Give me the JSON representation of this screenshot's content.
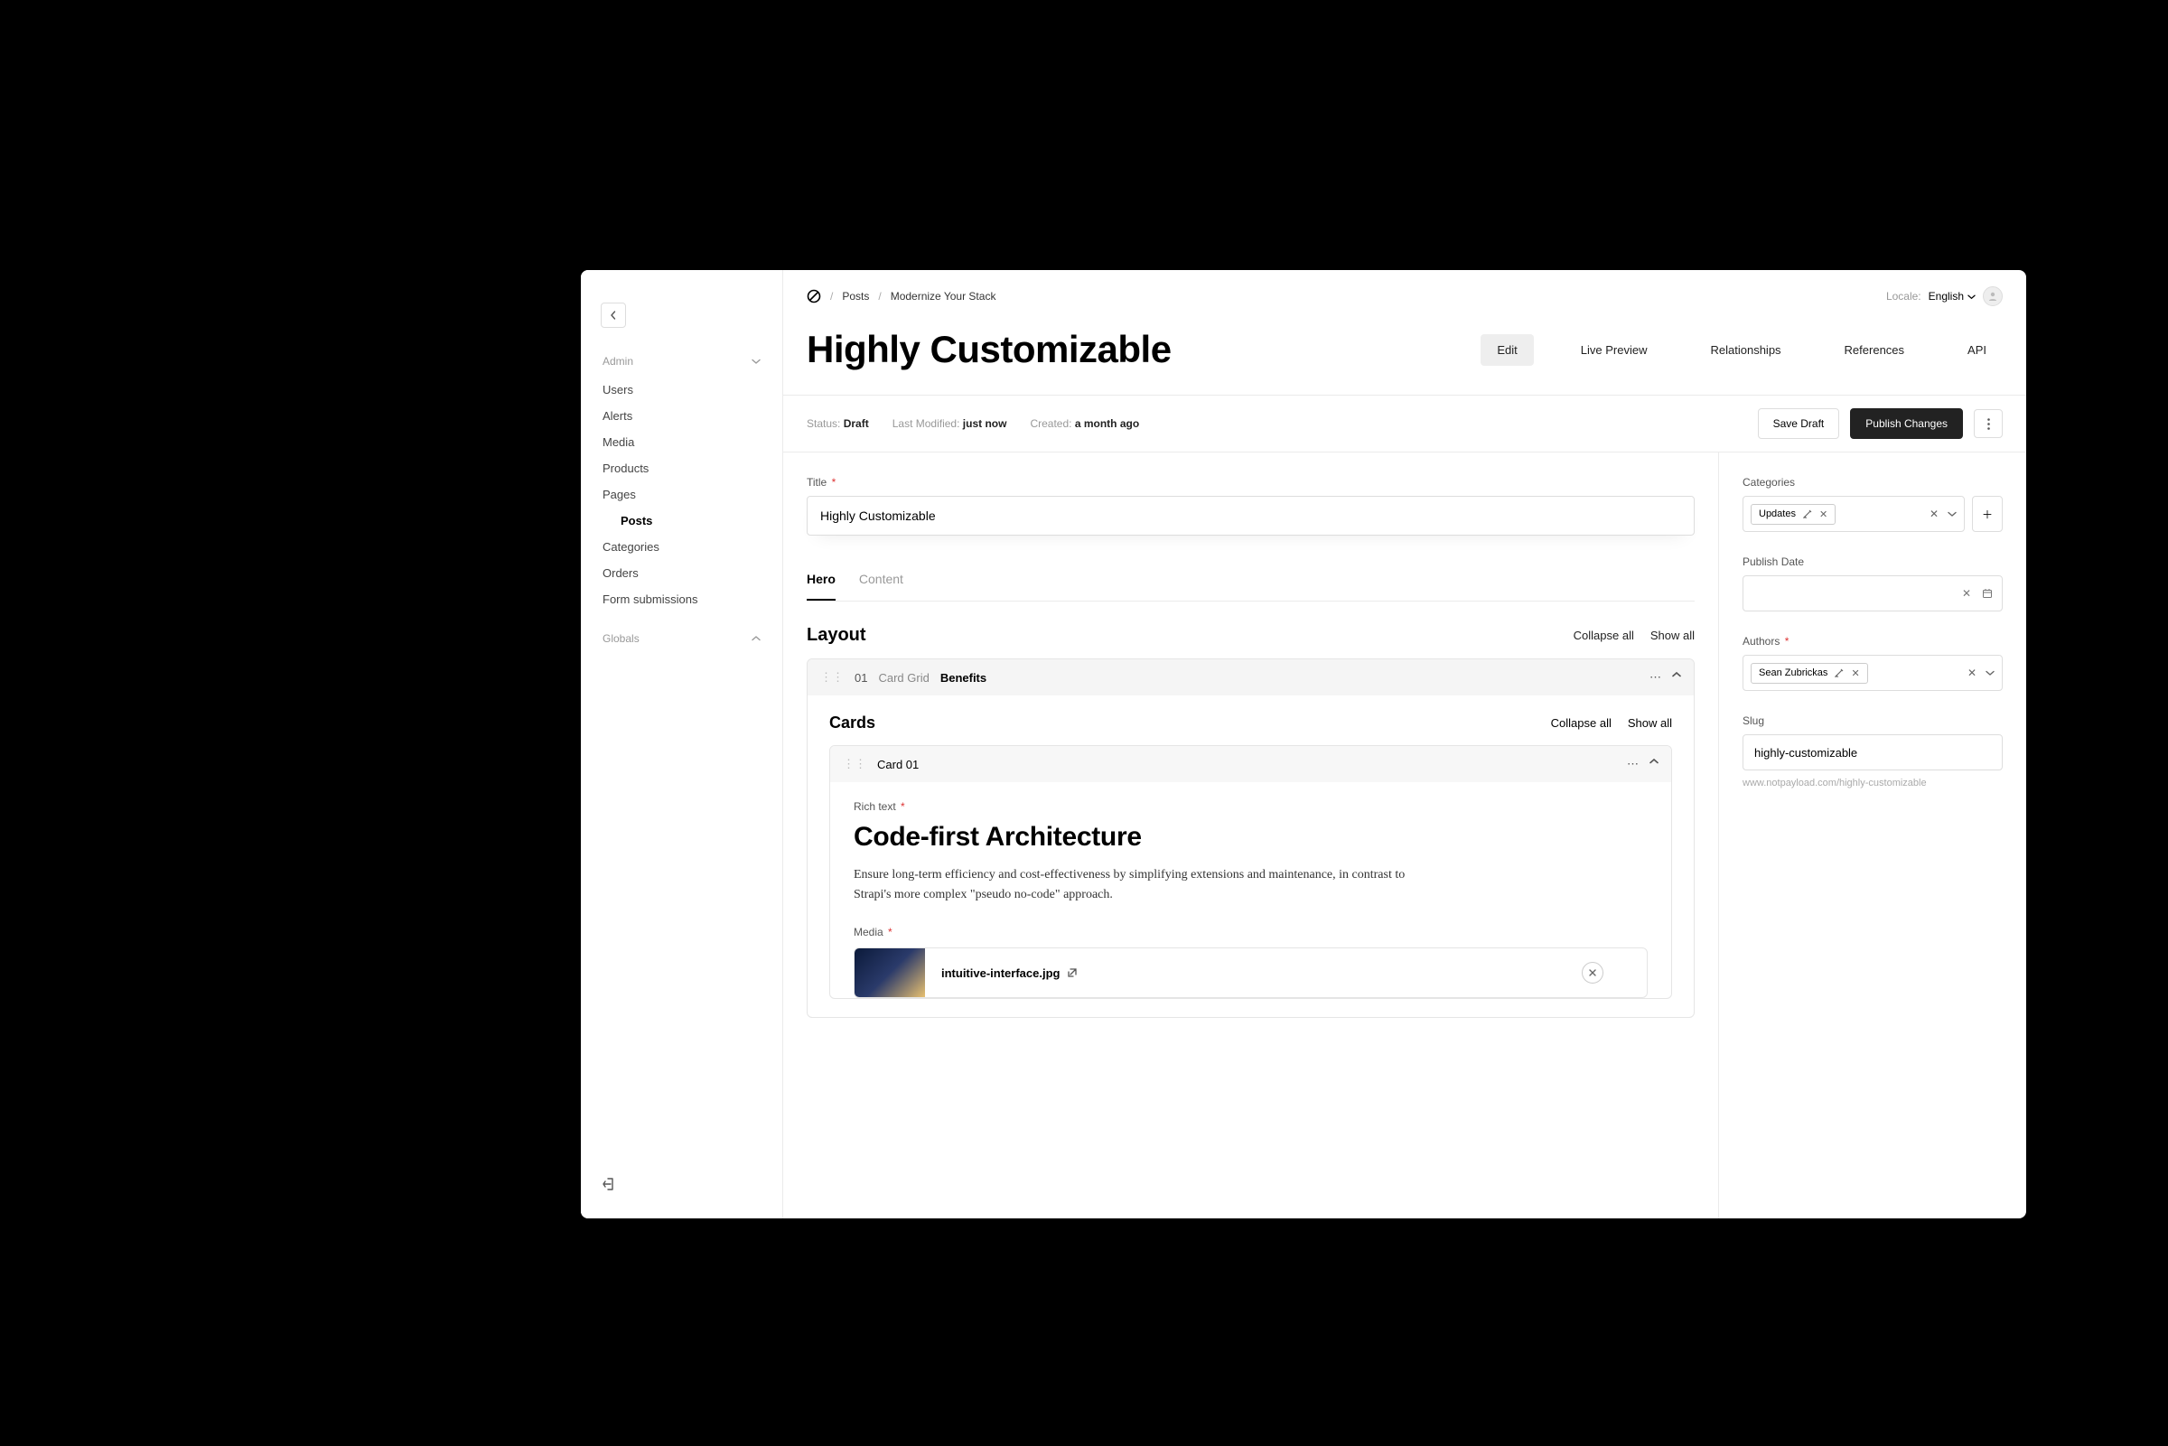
{
  "breadcrumbs": {
    "root": "Posts",
    "current": "Modernize Your Stack"
  },
  "locale": {
    "label": "Locale:",
    "value": "English"
  },
  "page_title": "Highly Customizable",
  "header_tabs": {
    "edit": "Edit",
    "live_preview": "Live Preview",
    "relationships": "Relationships",
    "references": "References",
    "api": "API"
  },
  "status": {
    "status_label": "Status:",
    "status_value": "Draft",
    "modified_label": "Last Modified:",
    "modified_value": "just now",
    "created_label": "Created:",
    "created_value": "a month ago"
  },
  "actions": {
    "save_draft": "Save Draft",
    "publish": "Publish Changes"
  },
  "sidebar": {
    "admin_label": "Admin",
    "globals_label": "Globals",
    "items": [
      "Users",
      "Alerts",
      "Media",
      "Products",
      "Pages",
      "Posts",
      "Categories",
      "Orders",
      "Form submissions"
    ]
  },
  "editor": {
    "title_label": "Title",
    "title_value": "Highly Customizable",
    "tabs": {
      "hero": "Hero",
      "content": "Content"
    },
    "layout_heading": "Layout",
    "collapse_all": "Collapse all",
    "show_all": "Show all",
    "block": {
      "num": "01",
      "type": "Card Grid",
      "name": "Benefits"
    },
    "cards_heading": "Cards",
    "card": {
      "name": "Card 01",
      "rich_label": "Rich text",
      "rich_heading": "Code-first Architecture",
      "rich_body": "Ensure long-term efficiency and cost-effectiveness by simplifying extensions and maintenance, in contrast to Strapi's more complex \"pseudo no-code\" approach.",
      "media_label": "Media",
      "media_filename": "intuitive-interface.jpg"
    }
  },
  "side": {
    "categories_label": "Categories",
    "category_pill": "Updates",
    "publish_date_label": "Publish Date",
    "authors_label": "Authors",
    "author_pill": "Sean Zubrickas",
    "slug_label": "Slug",
    "slug_value": "highly-customizable",
    "slug_url": "www.notpayload.com/highly-customizable"
  }
}
